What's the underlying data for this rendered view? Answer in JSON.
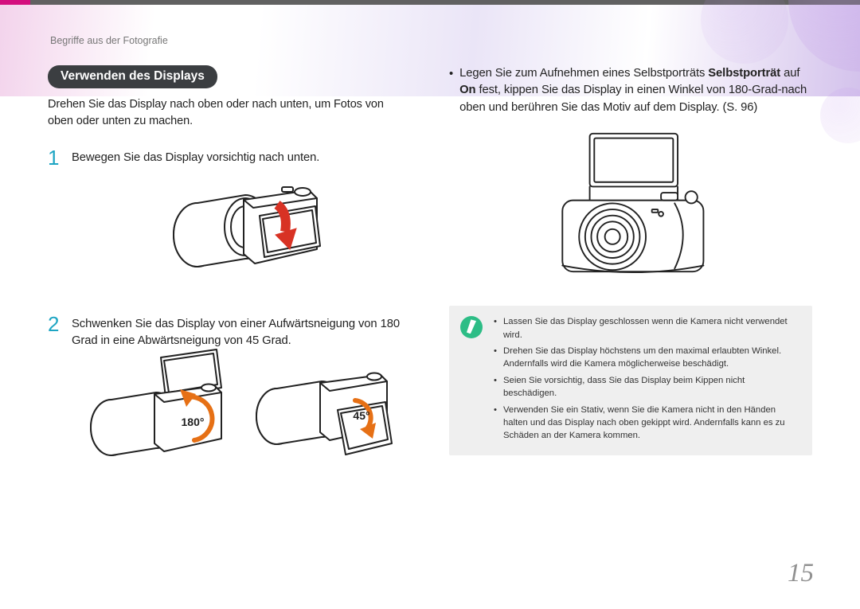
{
  "breadcrumb": "Begriffe aus der Fotografie",
  "section_title": "Verwenden des Displays",
  "intro": "Drehen Sie das Display nach oben oder nach unten, um Fotos von oben oder unten zu machen.",
  "steps": [
    {
      "num": "1",
      "text": "Bewegen Sie das Display vorsichtig nach unten."
    },
    {
      "num": "2",
      "text": "Schwenken Sie das Display von einer Aufwärtsneigung von 180 Grad in eine Abwärtsneigung von 45 Grad."
    }
  ],
  "angle_labels": {
    "up": "180°",
    "down": "45°"
  },
  "right_bullet": {
    "pre": "Legen Sie zum Aufnehmen eines Selbstporträts ",
    "bold1": "Selbstporträt",
    "mid": " auf ",
    "bold2": "On",
    "post": " fest, kippen Sie das Display in einen Winkel von 180-Grad-nach oben und berühren Sie das Motiv auf dem Display. (S. 96)"
  },
  "note_items": [
    "Lassen Sie das Display geschlossen wenn die Kamera nicht verwendet wird.",
    "Drehen Sie das Display höchstens um den maximal erlaubten Winkel. Andernfalls wird die Kamera möglicherweise beschädigt.",
    "Seien Sie vorsichtig, dass Sie das Display beim Kippen nicht beschädigen.",
    "Verwenden Sie ein Stativ, wenn Sie die Kamera nicht in den Händen halten und das Display nach oben gekippt wird. Andernfalls kann es zu Schäden an der Kamera kommen."
  ],
  "page_number": "15"
}
